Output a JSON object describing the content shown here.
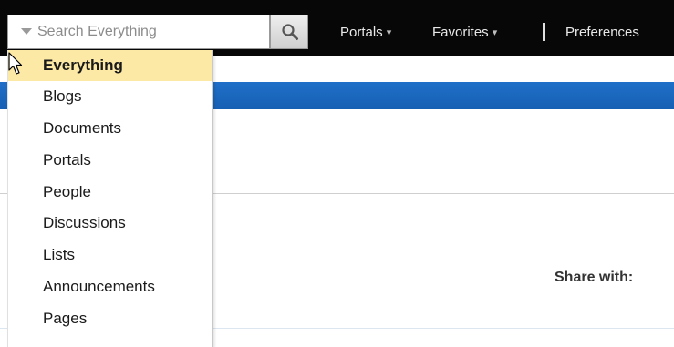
{
  "search": {
    "placeholder": "Search Everything"
  },
  "nav": {
    "portals": "Portals",
    "favorites": "Favorites",
    "preferences": "Preferences"
  },
  "dropdown": {
    "items": [
      "Everything",
      "Blogs",
      "Documents",
      "Portals",
      "People",
      "Discussions",
      "Lists",
      "Announcements",
      "Pages"
    ],
    "selected": "Everything"
  },
  "share": {
    "label": "Share with:"
  },
  "icons": {
    "search_button": "search-icon",
    "scope": "triangle-down-icon",
    "pointer": "mouse-cursor-icon"
  },
  "colors": {
    "topbar": "#070707",
    "band": "#1f6fc8",
    "selected_item": "#fde9a6"
  }
}
